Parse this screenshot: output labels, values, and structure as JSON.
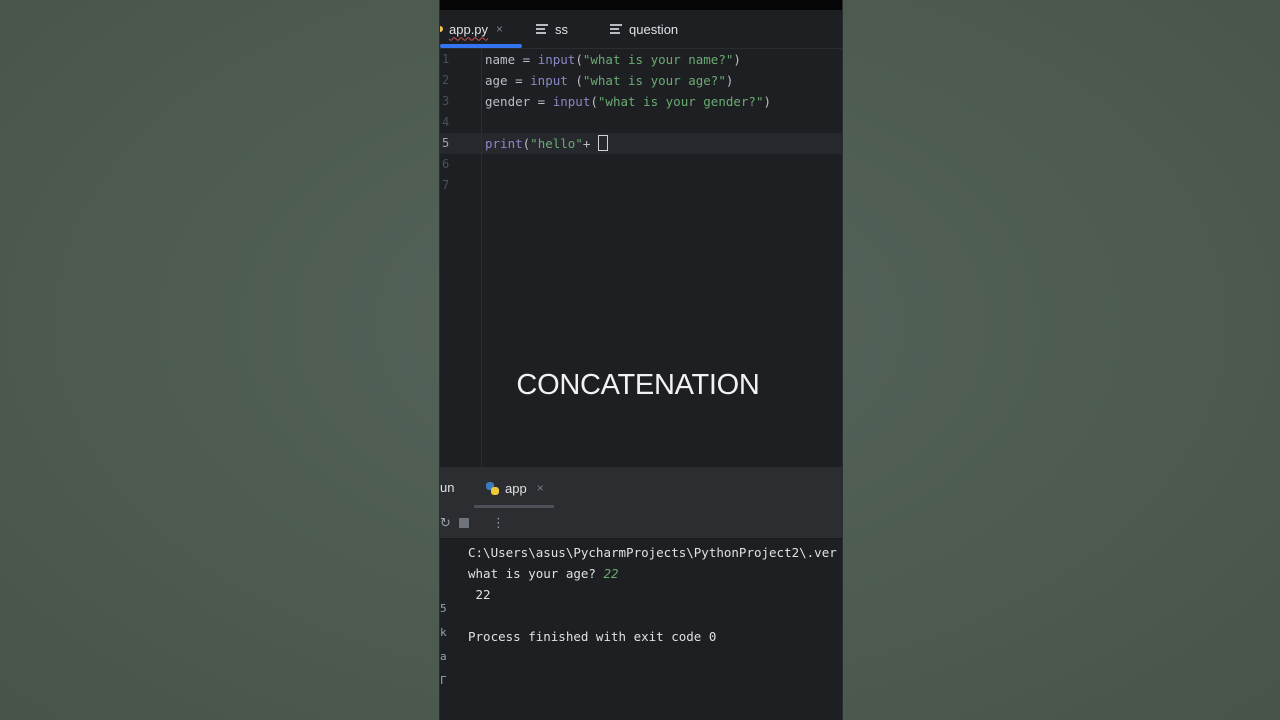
{
  "tabs": [
    {
      "label": "app.py",
      "active": true,
      "close": "×"
    },
    {
      "label": "ss",
      "active": false
    },
    {
      "label": "question",
      "active": false
    }
  ],
  "editor": {
    "line_numbers": [
      "1",
      "2",
      "3",
      "4",
      "5",
      "6",
      "7"
    ],
    "line1": {
      "var": "name = ",
      "fn": "input",
      "rest1": "(",
      "str": "\"what is your name?\"",
      "rest2": ")"
    },
    "line2": {
      "var": "age = ",
      "fn": "input",
      "rest1": " (",
      "str": "\"what is your age?\"",
      "rest2": ")"
    },
    "line3": {
      "var": "gender = ",
      "fn": "input",
      "rest1": "(",
      "str": "\"what is your gender?\"",
      "rest2": ")"
    },
    "line5": {
      "fn": "print",
      "rest1": "(",
      "str": "\"hello\"",
      "rest2": "+ "
    },
    "current_line": "5"
  },
  "overlay_text": "CONCATENATION",
  "run_panel": {
    "label": "un",
    "tab_label": "app",
    "tab_close": "×",
    "menu_icon": "⋮",
    "side_icons": [
      "5",
      "k",
      "a",
      "Γ"
    ],
    "console": {
      "path": "C:\\Users\\asus\\PycharmProjects\\PythonProject2\\.ver",
      "prompt": "what is your age? ",
      "prompt_input": "22",
      "output": " 22",
      "finished": "Process finished with exit code 0"
    }
  },
  "colors": {
    "editor_bg": "#1e1f22",
    "accent_tab": "#3574f0",
    "string": "#6aab73",
    "builtin": "#8888c6"
  }
}
